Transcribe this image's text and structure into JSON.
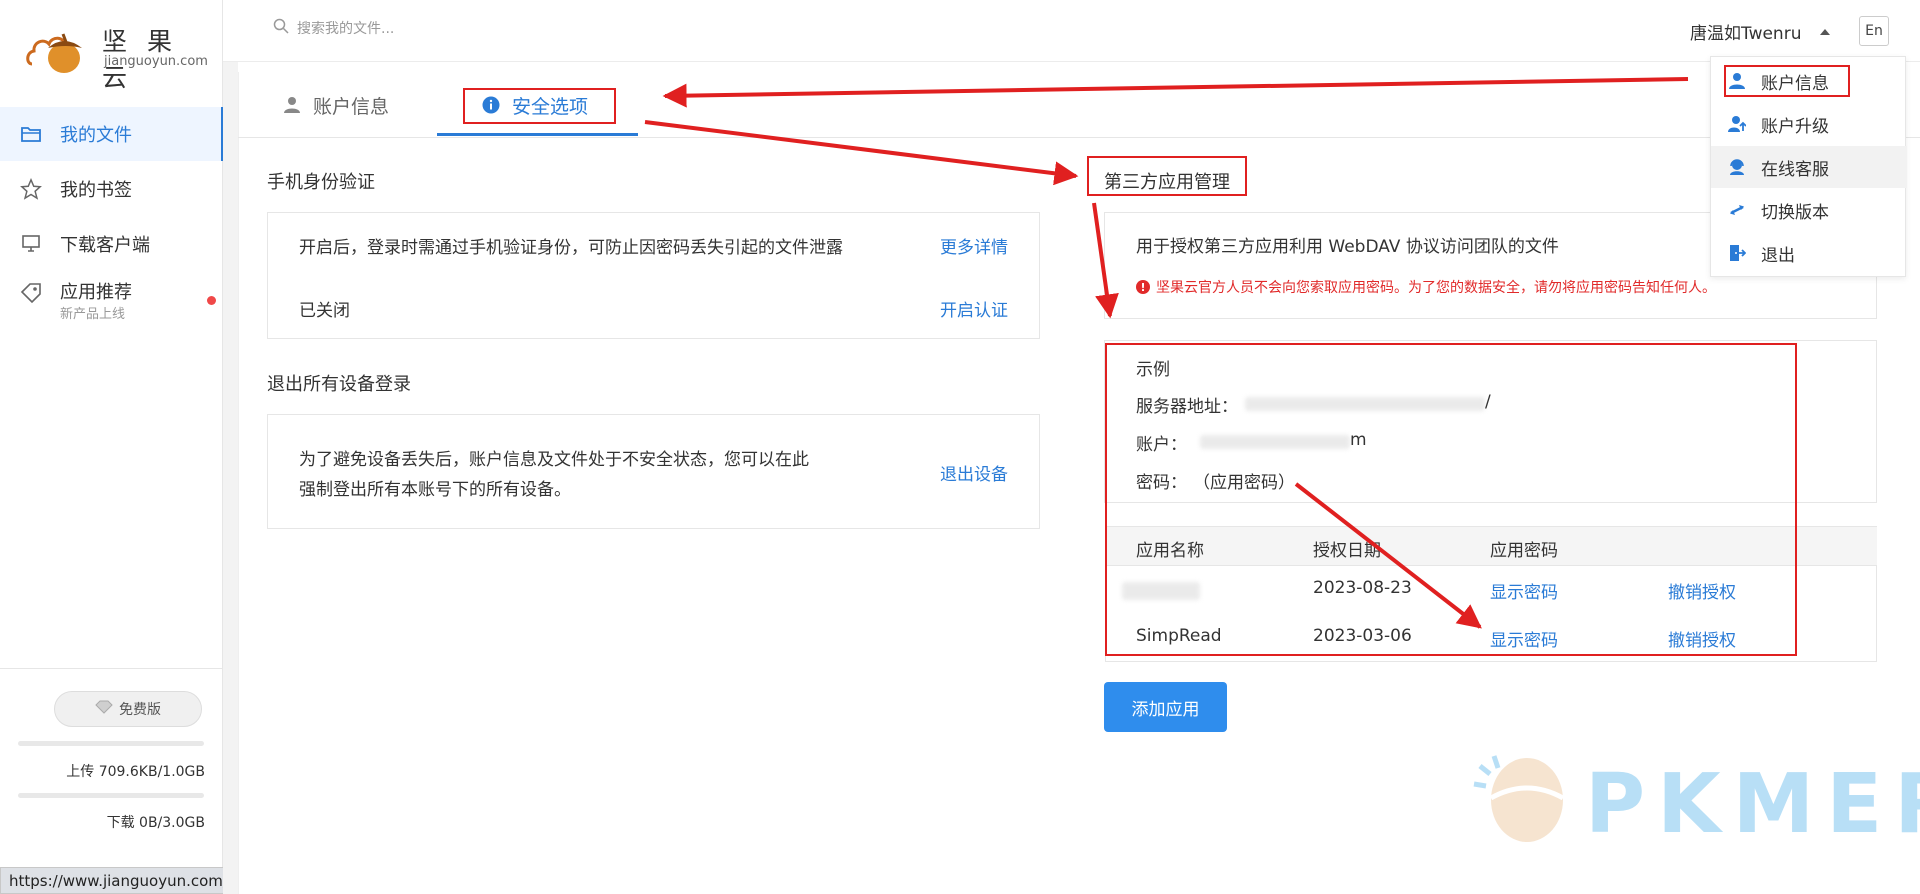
{
  "brand": {
    "name": "坚 果 云",
    "domain": "jianguoyun.com"
  },
  "search": {
    "placeholder": "搜索我的文件..."
  },
  "user": {
    "name": "唐温如Twenru",
    "lang_button": "En"
  },
  "sidebar": {
    "items": [
      {
        "label": "我的文件",
        "icon": "folder-icon",
        "active": true
      },
      {
        "label": "我的书签",
        "icon": "star-icon"
      },
      {
        "label": "下载客户端",
        "icon": "monitor-icon"
      },
      {
        "label": "应用推荐",
        "sub": "新产品上线",
        "icon": "tag-icon",
        "dot": true
      }
    ],
    "plan": "免费版",
    "upload": "上传 709.6KB/1.0GB",
    "download": "下载 0B/3.0GB"
  },
  "status_url": "https://www.jianguoyun.com/s/helpdesk",
  "tabs": [
    {
      "label": "账户信息",
      "icon": "user-icon"
    },
    {
      "label": "安全选项",
      "icon": "info-icon",
      "active": true
    }
  ],
  "phone_auth": {
    "title": "手机身份验证",
    "description": "开启后，登录时需通过手机验证身份，可防止因密码丢失引起的文件泄露",
    "more_link": "更多详情",
    "status": "已关闭",
    "enable_link": "开启认证"
  },
  "logout_all": {
    "title": "退出所有设备登录",
    "description_line1": "为了避免设备丢失后，账户信息及文件处于不安全状态，您可以在此",
    "description_line2": "强制登出所有本账号下的所有设备。",
    "action_link": "退出设备"
  },
  "third_party": {
    "title": "第三方应用管理",
    "description": "用于授权第三方应用利用 WebDAV 协议访问团队的文件",
    "warning": "坚果云官方人员不会向您索取应用密码。为了您的数据安全，请勿将应用密码告知任何人。",
    "example": {
      "title": "示例",
      "server_label": "服务器地址：",
      "server_value_visible": "/",
      "account_label": "账户：",
      "account_value_visible": "m",
      "password_label": "密码：",
      "password_value": "（应用密码）"
    },
    "table": {
      "headers": [
        "应用名称",
        "授权日期",
        "应用密码"
      ],
      "rows": [
        {
          "name": "",
          "date": "2023-08-23",
          "show_pwd": "显示密码",
          "revoke": "撤销授权"
        },
        {
          "name": "SimpRead",
          "date": "2023-03-06",
          "show_pwd": "显示密码",
          "revoke": "撤销授权"
        }
      ]
    },
    "add_button": "添加应用"
  },
  "dropdown": {
    "items": [
      {
        "label": "账户信息",
        "icon": "user-icon"
      },
      {
        "label": "账户升级",
        "icon": "upgrade-icon"
      },
      {
        "label": "在线客服",
        "icon": "support-icon"
      },
      {
        "label": "切换版本",
        "icon": "switch-icon"
      },
      {
        "label": "退出",
        "icon": "logout-icon"
      }
    ]
  },
  "watermark": {
    "text": "PKMER"
  },
  "colors": {
    "accent": "#2a7bd6",
    "annotation_red": "#e02020",
    "warning": "#e12a2a",
    "button": "#2f8ded"
  }
}
